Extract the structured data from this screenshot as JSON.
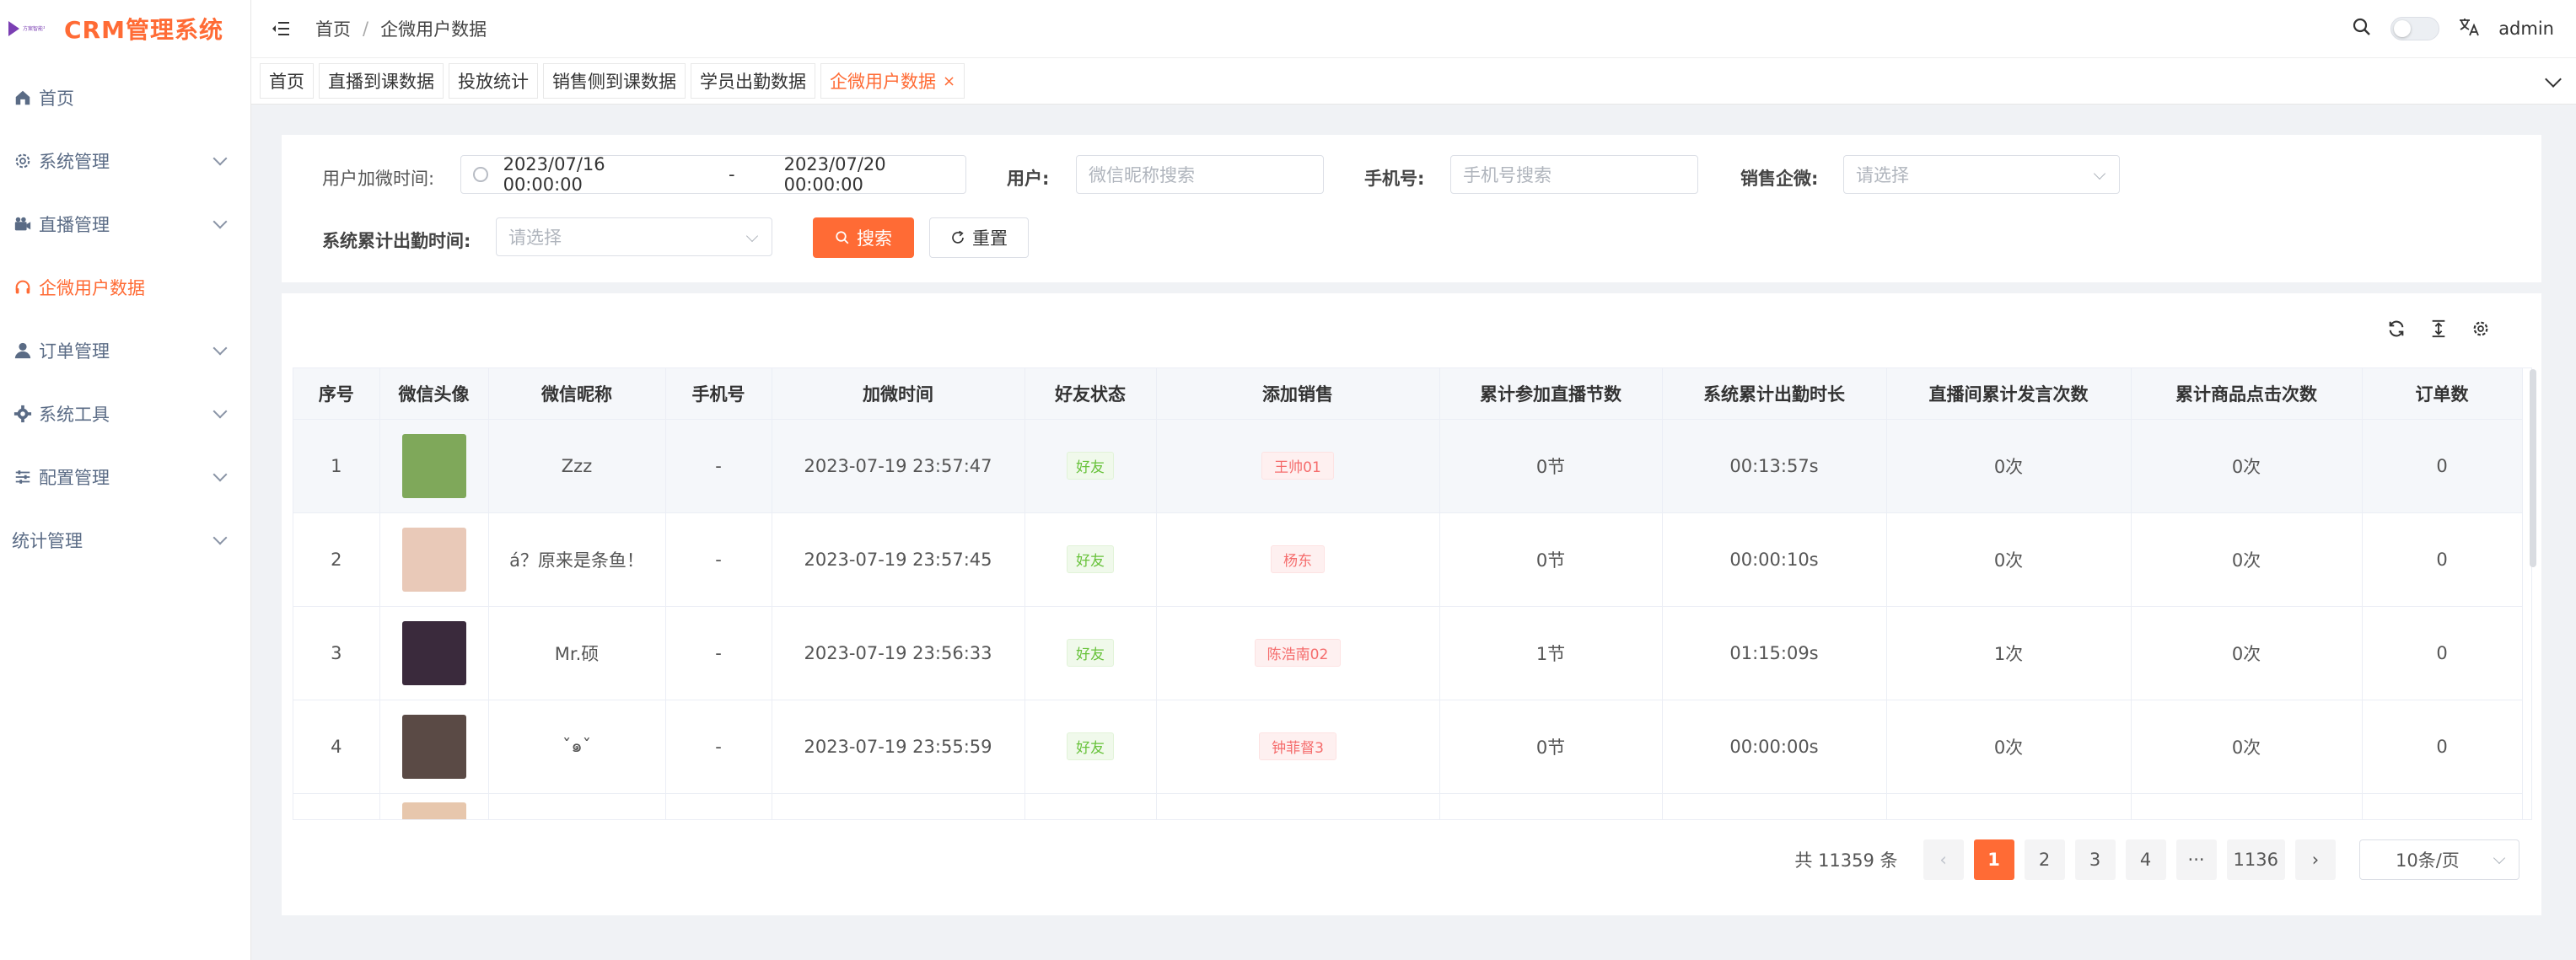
{
  "sidebar": {
    "logo_small_text": "方案智能平台",
    "title": "CRM管理系统",
    "items": [
      {
        "label": "首页",
        "icon": "home-icon",
        "active": false,
        "expandable": false
      },
      {
        "label": "系统管理",
        "icon": "gear-icon",
        "active": false,
        "expandable": true
      },
      {
        "label": "直播管理",
        "icon": "camera-icon",
        "active": false,
        "expandable": true
      },
      {
        "label": "企微用户数据",
        "icon": "headset-icon",
        "active": true,
        "expandable": false
      },
      {
        "label": "订单管理",
        "icon": "user-icon",
        "active": false,
        "expandable": true
      },
      {
        "label": "系统工具",
        "icon": "tool-icon",
        "active": false,
        "expandable": true
      },
      {
        "label": "配置管理",
        "icon": "sliders-icon",
        "active": false,
        "expandable": true
      },
      {
        "label": "统计管理",
        "icon": "",
        "active": false,
        "expandable": true
      }
    ]
  },
  "header": {
    "breadcrumb": [
      "首页",
      "企微用户数据"
    ],
    "breadcrumb_sep": "/",
    "user": "admin"
  },
  "tabs": [
    {
      "label": "首页",
      "active": false
    },
    {
      "label": "直播到课数据",
      "active": false
    },
    {
      "label": "投放统计",
      "active": false
    },
    {
      "label": "销售侧到课数据",
      "active": false
    },
    {
      "label": "学员出勤数据",
      "active": false
    },
    {
      "label": "企微用户数据",
      "active": true,
      "close": "×"
    }
  ],
  "search": {
    "date_label": "用户加微时间:",
    "date_start": "2023/07/16 00:00:00",
    "date_sep": "-",
    "date_end": "2023/07/20 00:00:00",
    "user_label": "用户:",
    "user_placeholder": "微信昵称搜索",
    "phone_label": "手机号:",
    "phone_placeholder": "手机号搜索",
    "sales_label": "销售企微:",
    "sales_placeholder": "请选择",
    "attend_label": "系统累计出勤时间:",
    "attend_placeholder": "请选择",
    "search_button": "搜索",
    "reset_button": "重置"
  },
  "table": {
    "columns": [
      "序号",
      "微信头像",
      "微信昵称",
      "手机号",
      "加微时间",
      "好友状态",
      "添加销售",
      "累计参加直播节数",
      "系统累计出勤时长",
      "直播间累计发言次数",
      "累计商品点击次数",
      "订单数"
    ],
    "rows": [
      {
        "no": "1",
        "avatar": "#7fa85a",
        "nickname": "Zzz",
        "phone": "-",
        "time": "2023-07-19 23:57:47",
        "status": "好友",
        "sales": "王帅01",
        "lessons": "0节",
        "duration": "00:13:57s",
        "speeches": "0次",
        "clicks": "0次",
        "orders": "0"
      },
      {
        "no": "2",
        "avatar": "#e9c9b8",
        "nickname": "á？原来是条鱼！",
        "phone": "-",
        "time": "2023-07-19 23:57:45",
        "status": "好友",
        "sales": "杨东",
        "lessons": "0节",
        "duration": "00:00:10s",
        "speeches": "0次",
        "clicks": "0次",
        "orders": "0"
      },
      {
        "no": "3",
        "avatar": "#3a2a3c",
        "nickname": "Mr.硕",
        "phone": "-",
        "time": "2023-07-19 23:56:33",
        "status": "好友",
        "sales": "陈浩南02",
        "lessons": "1节",
        "duration": "01:15:09s",
        "speeches": "1次",
        "clicks": "0次",
        "orders": "0"
      },
      {
        "no": "4",
        "avatar": "#5a4a45",
        "nickname": "ˇ๑ˇ",
        "phone": "-",
        "time": "2023-07-19 23:55:59",
        "status": "好友",
        "sales": "钟菲督3",
        "lessons": "0节",
        "duration": "00:00:00s",
        "speeches": "0次",
        "clicks": "0次",
        "orders": "0"
      }
    ],
    "partial_avatar": "#e7c7ad"
  },
  "pagination": {
    "total": "共 11359 条",
    "pages": [
      "1",
      "2",
      "3",
      "4",
      "···",
      "1136"
    ],
    "active_page": "1",
    "prev": "‹",
    "next": "›",
    "page_size": "10条/页"
  },
  "colors": {
    "accent": "#ff6b35",
    "friend_tag": "#67c23a",
    "sales_tag": "#f56c6c"
  }
}
